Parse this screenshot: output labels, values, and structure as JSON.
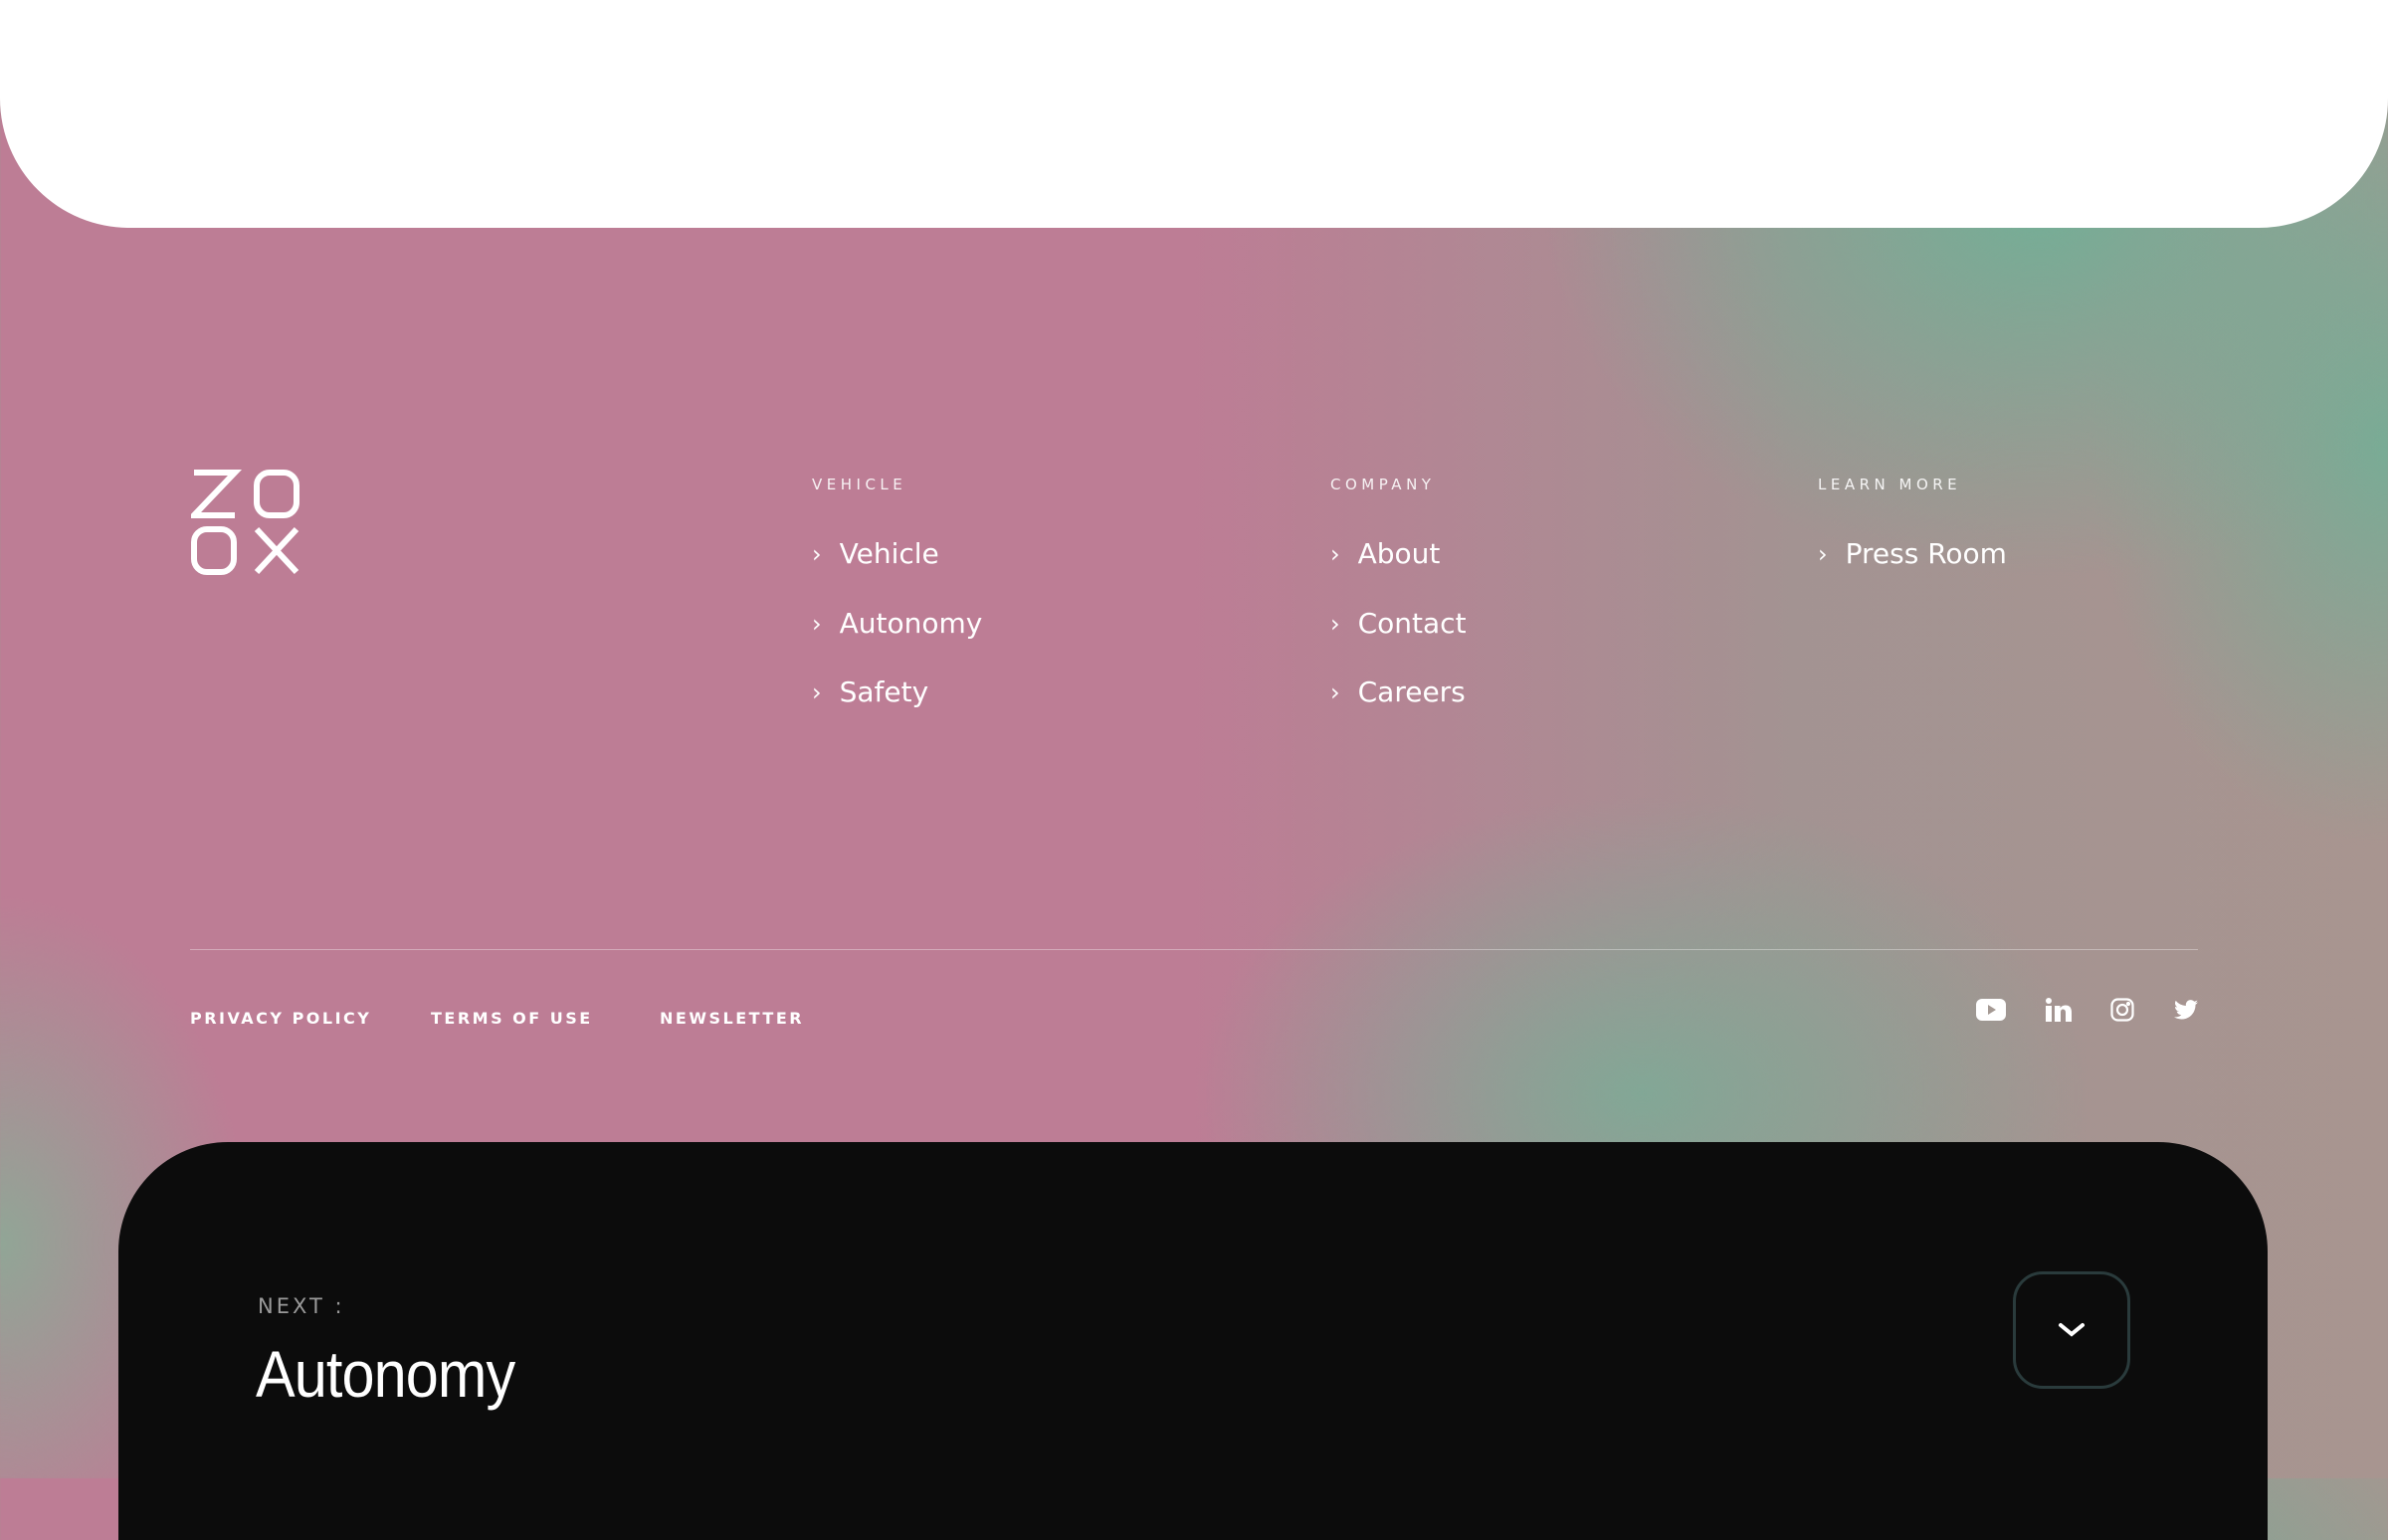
{
  "brand": {
    "logo_text": "ZOOX"
  },
  "columns": [
    {
      "heading": "VEHICLE",
      "links": [
        "Vehicle",
        "Autonomy",
        "Safety"
      ]
    },
    {
      "heading": "COMPANY",
      "links": [
        "About",
        "Contact",
        "Careers"
      ]
    },
    {
      "heading": "LEARN MORE",
      "links": [
        "Press Room"
      ]
    }
  ],
  "chevron": "›",
  "legal": {
    "privacy": "PRIVACY POLICY",
    "terms": "TERMS OF USE",
    "newsletter": "NEWSLETTER"
  },
  "social": [
    "youtube-icon",
    "linkedin-icon",
    "instagram-icon",
    "twitter-icon"
  ],
  "next": {
    "label": "NEXT :",
    "title": "Autonomy"
  },
  "colors": {
    "background": "#bd7d95",
    "accent_green": "#74ae96",
    "card_dark": "#0c0c0c"
  }
}
